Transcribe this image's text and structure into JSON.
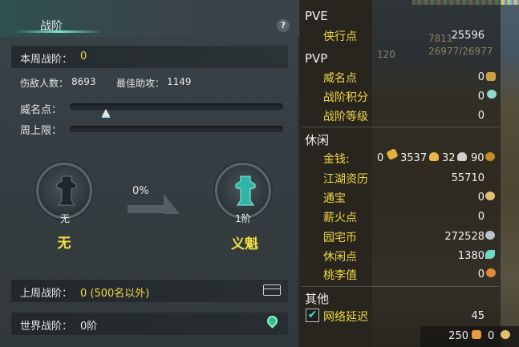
{
  "left_panel": {
    "title": "战阶",
    "help": "?",
    "weekly_rank": {
      "label": "本周战阶：",
      "value": "0"
    },
    "kills": {
      "label": "伤敌人数：",
      "value": "8693"
    },
    "best_assist": {
      "label": "最佳助攻：",
      "value": "1149"
    },
    "prestige_label": "威名点：",
    "prestige_progress": 0.16,
    "weekly_cap_label": "周上限：",
    "weekly_cap_progress": 0,
    "current_emblem": {
      "tier": "无",
      "name": "无"
    },
    "progress_percent": "0%",
    "next_emblem": {
      "tier": "1阶",
      "name": "义魁"
    },
    "last_week": {
      "label": "上周战阶：",
      "value": "0 (500名以外)"
    },
    "world_rank": {
      "label": "世界战阶：",
      "value": "0阶"
    }
  },
  "right_panel": {
    "pve": {
      "header": "PVE",
      "items": [
        {
          "label": "侠行点",
          "value": "25596"
        }
      ]
    },
    "pvp": {
      "header": "PVP",
      "items": [
        {
          "label": "威名点",
          "value": "0"
        },
        {
          "label": "战阶积分",
          "value": "0"
        },
        {
          "label": "战阶等级",
          "value": "0"
        }
      ]
    },
    "leisure": {
      "header": "休闲",
      "money": {
        "label": "金钱:",
        "v1": "0",
        "v2": "3537",
        "v3": "32",
        "v4": "90"
      },
      "items": [
        {
          "label": "江湖资历",
          "value": "55710"
        },
        {
          "label": "通宝",
          "value": "0"
        },
        {
          "label": "薪火点",
          "value": "0"
        },
        {
          "label": "园宅币",
          "value": "272528"
        },
        {
          "label": "休闲点",
          "value": "1380"
        },
        {
          "label": "桃李值",
          "value": "0"
        }
      ]
    },
    "other": {
      "header": "其他",
      "items": [
        {
          "label": "网络延迟",
          "value": "45",
          "checked": true
        }
      ]
    },
    "bottom": {
      "v1": "250",
      "v2": "0"
    },
    "background_text": {
      "a": "7811",
      "b": "26977/26977",
      "c": "120"
    }
  },
  "colors": {
    "accent": "#f2d845",
    "teal": "#3fe0c0"
  },
  "icons": [
    "help-icon",
    "emblem-bottle-icon",
    "arrow-right-icon",
    "chest-icon",
    "map-pin-icon",
    "coin-icon",
    "ingot-icon",
    "check-icon"
  ]
}
